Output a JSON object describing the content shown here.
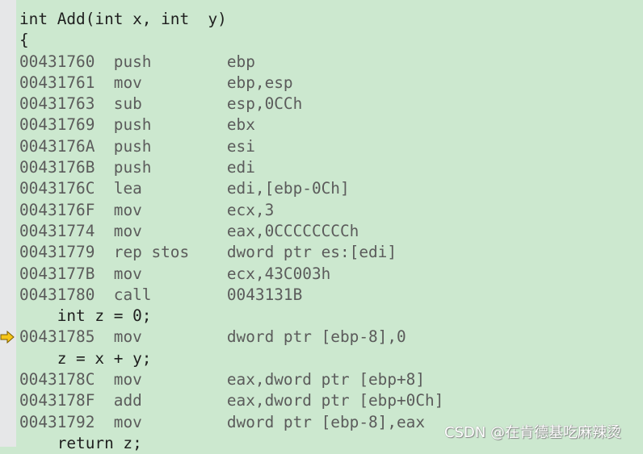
{
  "lines": [
    {
      "type": "src",
      "text": "int Add(int x, int  y)"
    },
    {
      "type": "src",
      "text": "{"
    },
    {
      "type": "asm",
      "addr": "00431760",
      "op": "push",
      "args": "ebp"
    },
    {
      "type": "asm",
      "addr": "00431761",
      "op": "mov",
      "args": "ebp,esp"
    },
    {
      "type": "asm",
      "addr": "00431763",
      "op": "sub",
      "args": "esp,0CCh"
    },
    {
      "type": "asm",
      "addr": "00431769",
      "op": "push",
      "args": "ebx"
    },
    {
      "type": "asm",
      "addr": "0043176A",
      "op": "push",
      "args": "esi"
    },
    {
      "type": "asm",
      "addr": "0043176B",
      "op": "push",
      "args": "edi"
    },
    {
      "type": "asm",
      "addr": "0043176C",
      "op": "lea",
      "args": "edi,[ebp-0Ch]"
    },
    {
      "type": "asm",
      "addr": "0043176F",
      "op": "mov",
      "args": "ecx,3"
    },
    {
      "type": "asm",
      "addr": "00431774",
      "op": "mov",
      "args": "eax,0CCCCCCCCh"
    },
    {
      "type": "asm",
      "addr": "00431779",
      "op": "rep stos",
      "args": "dword ptr es:[edi]"
    },
    {
      "type": "asm",
      "addr": "0043177B",
      "op": "mov",
      "args": "ecx,43C003h"
    },
    {
      "type": "asm",
      "addr": "00431780",
      "op": "call",
      "args": "0043131B"
    },
    {
      "type": "src",
      "text": "    int z = 0;"
    },
    {
      "type": "asm",
      "addr": "00431785",
      "op": "mov",
      "args": "dword ptr [ebp-8],0",
      "current": true
    },
    {
      "type": "src",
      "text": "    z = x + y;"
    },
    {
      "type": "asm",
      "addr": "0043178C",
      "op": "mov",
      "args": "eax,dword ptr [ebp+8]"
    },
    {
      "type": "asm",
      "addr": "0043178F",
      "op": "add",
      "args": "eax,dword ptr [ebp+0Ch]"
    },
    {
      "type": "asm",
      "addr": "00431792",
      "op": "mov",
      "args": "dword ptr [ebp-8],eax"
    },
    {
      "type": "src",
      "text": "    return z;"
    }
  ],
  "current_instruction_icon": "instruction-pointer-arrow-icon",
  "colors": {
    "background": "#cce8cf",
    "gutter": "#e6e7e8",
    "source": "#1e1e1e",
    "disassembly": "#5b5b5b",
    "arrow": "#f5c518"
  },
  "watermark": "CSDN @在肯德基吃麻辣烫"
}
